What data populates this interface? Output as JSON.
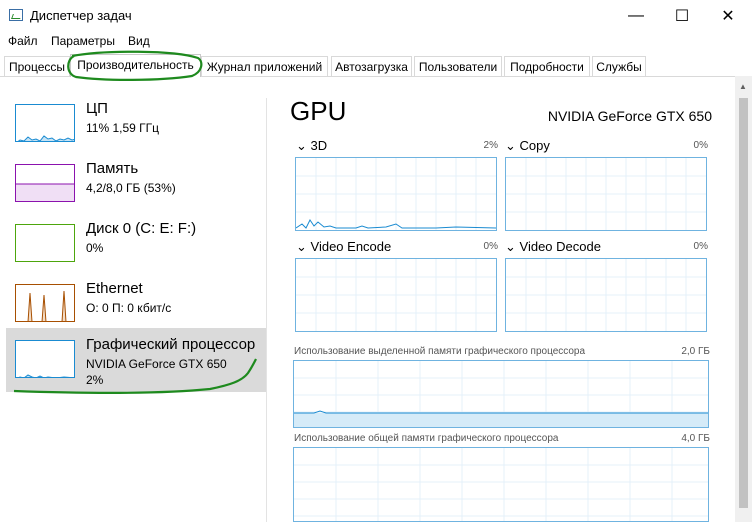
{
  "window": {
    "title": "Диспетчер задач",
    "minimize": "—",
    "maximize": "☐",
    "close": "✕"
  },
  "menu": [
    "Файл",
    "Параметры",
    "Вид"
  ],
  "tabs": [
    "Процессы",
    "Производительность",
    "Журнал приложений",
    "Автозагрузка",
    "Пользователи",
    "Подробности",
    "Службы"
  ],
  "active_tab": "Производительность",
  "sidebar": {
    "items": [
      {
        "name": "ЦП",
        "sub": "11% 1,59 ГГц",
        "sub2": ""
      },
      {
        "name": "Память",
        "sub": "4,2/8,0 ГБ (53%)",
        "sub2": ""
      },
      {
        "name": "Диск 0 (C: E: F:)",
        "sub": "0%",
        "sub2": ""
      },
      {
        "name": "Ethernet",
        "sub": "О: 0 П: 0 кбит/с",
        "sub2": ""
      },
      {
        "name": "Графический процессор",
        "sub": "NVIDIA GeForce GTX 650",
        "sub2": "2%"
      }
    ],
    "selected": "Графический процессор"
  },
  "main": {
    "title": "GPU",
    "model": "NVIDIA GeForce GTX 650",
    "engines": [
      {
        "name": "3D",
        "pct": "2%"
      },
      {
        "name": "Copy",
        "pct": "0%"
      },
      {
        "name": "Video Encode",
        "pct": "0%"
      },
      {
        "name": "Video Decode",
        "pct": "0%"
      }
    ],
    "dedicated": {
      "label": "Использование выделенной памяти графического процессора",
      "max": "2,0 ГБ"
    },
    "shared": {
      "label": "Использование общей памяти графического процессора",
      "max": "4,0 ГБ"
    }
  },
  "colors": {
    "cpu": "#1a8bd1",
    "memory": "#8b12ae",
    "disk": "#4da60c",
    "ethernet": "#a74f01",
    "gpu": "#1a8bd1",
    "annotation": "#1e8a1e"
  }
}
